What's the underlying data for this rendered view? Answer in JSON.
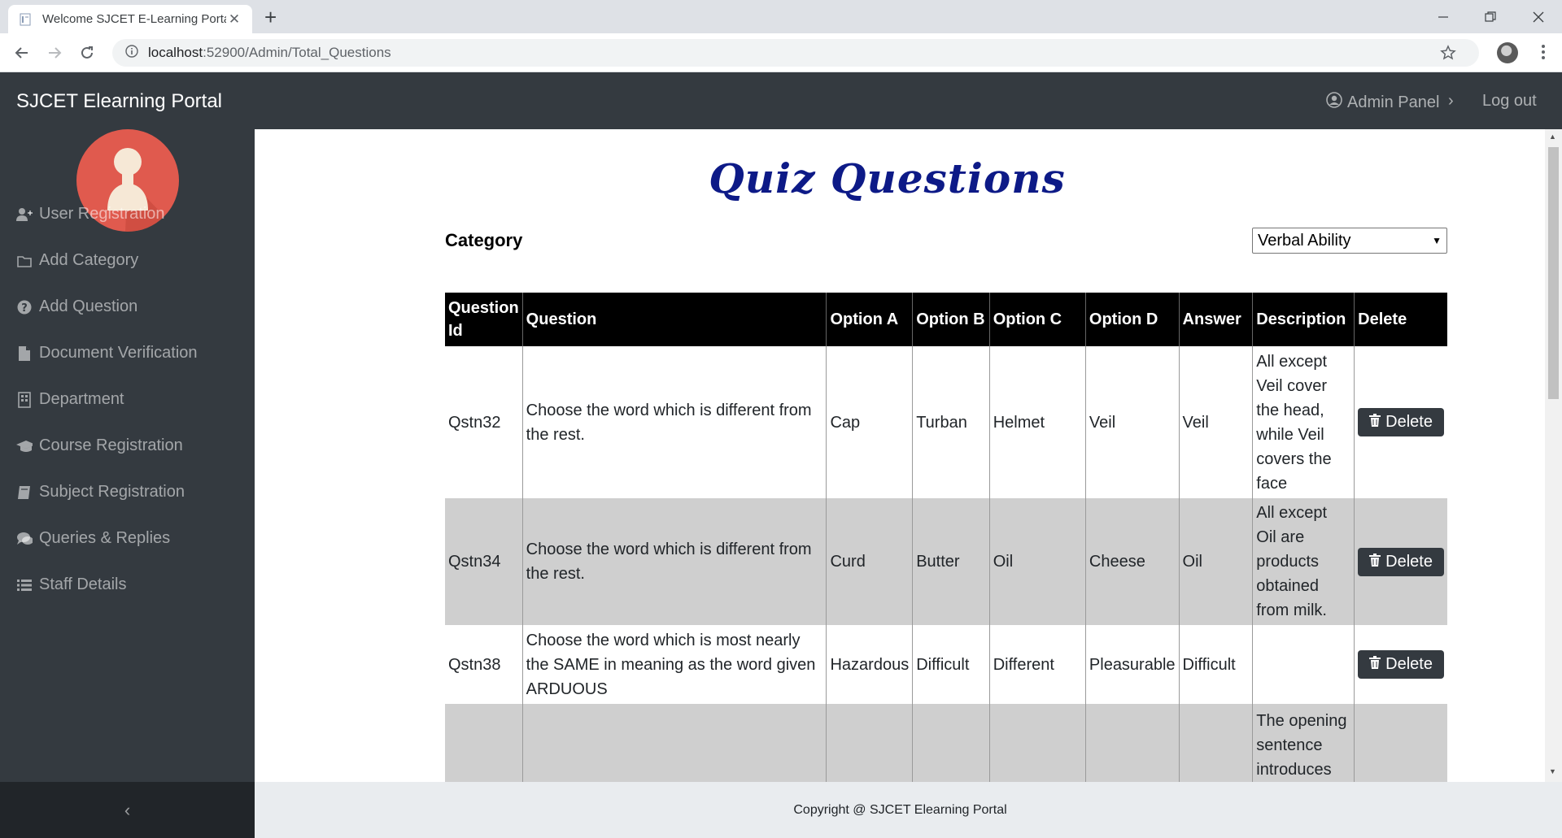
{
  "browser": {
    "tab_title": "Welcome SJCET E-Learning Porta",
    "url_host": "localhost",
    "url_path": ":52900/Admin/Total_Questions",
    "new_tab": "+",
    "close_tab": "✕"
  },
  "header": {
    "brand": "SJCET Elearning Portal",
    "admin_panel": "Admin Panel",
    "chevron": "›",
    "logout": "Log out"
  },
  "sidebar": {
    "items": [
      {
        "label": "User Registration",
        "icon": "user-plus-icon"
      },
      {
        "label": "Add Category",
        "icon": "folder-icon"
      },
      {
        "label": "Add Question",
        "icon": "question-circle-icon"
      },
      {
        "label": "Document Verification",
        "icon": "file-icon"
      },
      {
        "label": "Department",
        "icon": "building-icon"
      },
      {
        "label": "Course Registration",
        "icon": "graduation-cap-icon"
      },
      {
        "label": "Subject Registration",
        "icon": "book-icon"
      },
      {
        "label": "Queries & Replies",
        "icon": "comments-icon"
      },
      {
        "label": "Staff Details",
        "icon": "list-icon"
      }
    ],
    "toggle": "‹"
  },
  "main": {
    "title": "Quiz Questions",
    "category_label": "Category",
    "category_selected": "Verbal Ability",
    "table": {
      "headers": [
        "Question Id",
        "Question",
        "Option A",
        "Option B",
        "Option C",
        "Option D",
        "Answer",
        "Description",
        "Delete"
      ],
      "rows": [
        {
          "id": "Qstn32",
          "question": "Choose the word which is different from the rest.",
          "a": "Cap",
          "b": "Turban",
          "c": "Helmet",
          "d": "Veil",
          "answer": "Veil",
          "description": "All except Veil cover the head, while Veil covers the face",
          "delete": "Delete"
        },
        {
          "id": "Qstn34",
          "question": "Choose the word which is different from the rest.",
          "a": "Curd",
          "b": "Butter",
          "c": "Oil",
          "d": "Cheese",
          "answer": "Oil",
          "description": "All except Oil are products obtained from milk.",
          "delete": "Delete"
        },
        {
          "id": "Qstn38",
          "question": "Choose the word which is most nearly the SAME in meaning as the word given ARDUOUS",
          "a": "Hazardous",
          "b": "Difficult",
          "c": "Different",
          "d": "Pleasurable",
          "answer": "Difficult",
          "description": "",
          "delete": "Delete"
        },
        {
          "id": "",
          "question": "",
          "a": "",
          "b": "",
          "c": "",
          "d": "",
          "answer": "",
          "description": "The opening sentence introduces us to the",
          "delete": ""
        }
      ]
    }
  },
  "footer": {
    "text": "Copyright @ SJCET Elearning Portal"
  }
}
